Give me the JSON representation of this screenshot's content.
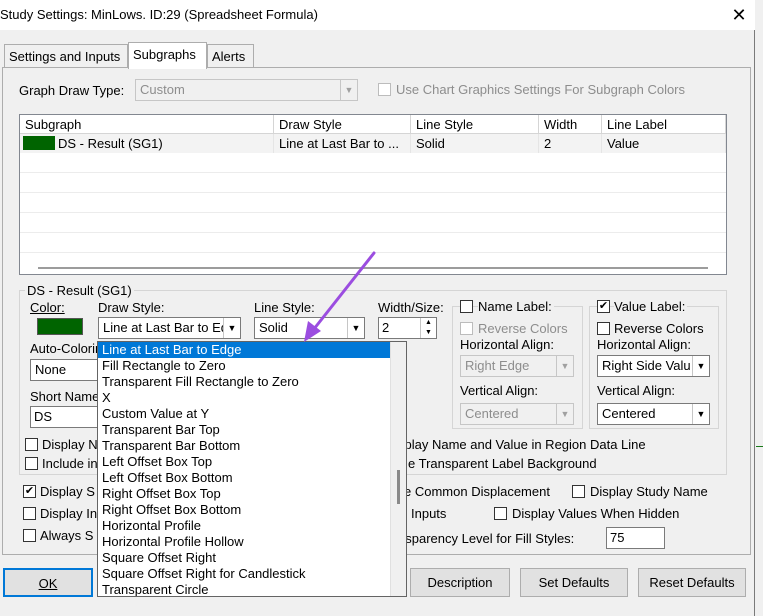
{
  "window": {
    "title": "Study Settings: MinLows. ID:29 (Spreadsheet Formula)",
    "close_glyph": "✕"
  },
  "tabs": [
    {
      "label": "Settings and Inputs"
    },
    {
      "label": "Subgraphs"
    },
    {
      "label": "Alerts"
    }
  ],
  "top": {
    "graph_draw_type_label": "Graph Draw Type:",
    "graph_draw_type_value": "Custom",
    "use_chart_graphics_label": "Use Chart Graphics Settings For Subgraph Colors"
  },
  "grid": {
    "columns": [
      "Subgraph",
      "Draw Style",
      "Line Style",
      "Width",
      "Line Label"
    ],
    "rows": [
      {
        "subgraph": "DS - Result (SG1)",
        "draw_style": "Line at Last Bar to ...",
        "line_style": "Solid",
        "width": "2",
        "line_label": "Value",
        "color": "#006400"
      }
    ]
  },
  "details": {
    "group_title": "DS - Result (SG1)",
    "color_label": "Color:",
    "color_value": "#006400",
    "draw_style_label": "Draw Style:",
    "draw_style_value": "Line at Last Bar to Ed",
    "line_style_label": "Line Style:",
    "line_style_value": "Solid",
    "width_size_label": "Width/Size:",
    "width_size_value": "2",
    "auto_coloring_label": "Auto-Coloring",
    "auto_coloring_value": "None",
    "short_name_label": "Short Name",
    "short_name_value": "DS",
    "name_label": {
      "title": "Name Label:",
      "reverse_colors": "Reverse Colors",
      "h_align_label": "Horizontal Align:",
      "h_align_value": "Right Edge",
      "v_align_label": "Vertical Align:",
      "v_align_value": "Centered"
    },
    "value_label": {
      "title": "Value Label:",
      "reverse_colors": "Reverse Colors",
      "h_align_label": "Horizontal Align:",
      "h_align_value": "Right Side Valu",
      "v_align_label": "Vertical Align:",
      "v_align_value": "Centered"
    },
    "display_n": "Display N",
    "display_region": "splay Name and Value in Region Data Line",
    "include_in": "Include in",
    "transparent_label_bg": "e Transparent Label Background"
  },
  "lower": {
    "display_s": "Display S",
    "common_displacement": "e Common Displacement",
    "display_study_name": "Display Study Name",
    "display_in": "Display In",
    "inputs": "Inputs",
    "display_values_hidden": "Display Values When Hidden",
    "always_s": "Always S",
    "transparency_label": "nsparency Level for Fill Styles:",
    "transparency_value": "75"
  },
  "dropdown": {
    "items": [
      "Line at Last Bar to Edge",
      "Fill Rectangle to Zero",
      "Transparent Fill Rectangle to Zero",
      "X",
      "Custom Value at Y",
      "Transparent Bar Top",
      "Transparent Bar Bottom",
      "Left Offset Box Top",
      "Left Offset Box Bottom",
      "Right Offset Box Top",
      "Right Offset Box Bottom",
      "Horizontal Profile",
      "Horizontal Profile Hollow",
      "Square Offset Right",
      "Square Offset Right for Candlestick",
      "Transparent Circle"
    ],
    "selected_index": 0
  },
  "buttons": {
    "ok": "OK",
    "description": "Description",
    "set_defaults": "Set Defaults",
    "reset_defaults": "Reset Defaults"
  },
  "colors": {
    "accent": "#0078d7",
    "annotation_arrow": "#9b4de0",
    "swatch": "#006400"
  }
}
